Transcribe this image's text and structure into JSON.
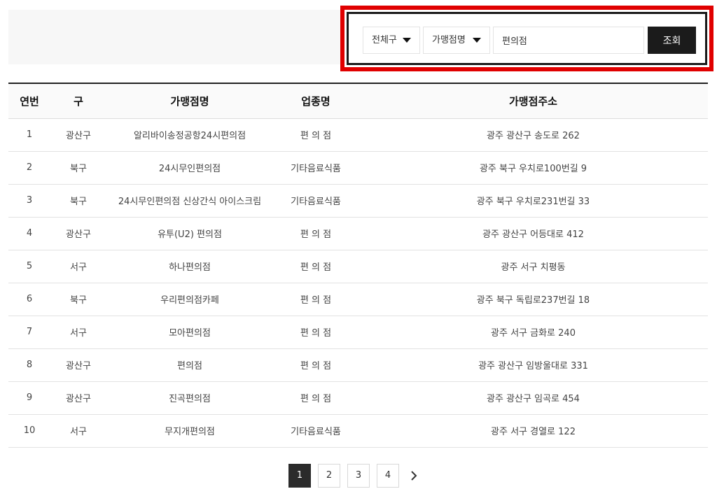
{
  "search": {
    "district_select": "전체구",
    "field_select": "가맹점명",
    "keyword_value": "편의점",
    "search_button": "조회"
  },
  "table": {
    "headers": [
      "연번",
      "구",
      "가맹점명",
      "업종명",
      "가맹점주소"
    ],
    "rows": [
      [
        "1",
        "광산구",
        "알리바이송정공항24시편의점",
        "편 의 점",
        "광주 광산구 송도로 262"
      ],
      [
        "2",
        "북구",
        "24시무인편의점",
        "기타음료식품",
        "광주 북구 우치로100번길 9"
      ],
      [
        "3",
        "북구",
        "24시무인편의점 신상간식 아이스크림",
        "기타음료식품",
        "광주 북구 우치로231번길 33"
      ],
      [
        "4",
        "광산구",
        "유투(U2) 편의점",
        "편 의 점",
        "광주 광산구 어등대로 412"
      ],
      [
        "5",
        "서구",
        "하나편의점",
        "편 의 점",
        "광주 서구 치평동"
      ],
      [
        "6",
        "북구",
        "우리편의점카페",
        "편 의 점",
        "광주 북구 독립로237번길 18"
      ],
      [
        "7",
        "서구",
        "모아편의점",
        "편 의 점",
        "광주 서구 금화로 240"
      ],
      [
        "8",
        "광산구",
        "편의점",
        "편 의 점",
        "광주 광산구 임방울대로 331"
      ],
      [
        "9",
        "광산구",
        "진곡편의점",
        "편 의 점",
        "광주 광산구 임곡로 454"
      ],
      [
        "10",
        "서구",
        "무지개편의점",
        "기타음료식품",
        "광주 서구 경열로 122"
      ]
    ]
  },
  "pagination": {
    "pages": [
      "1",
      "2",
      "3",
      "4"
    ],
    "current": "1",
    "next_icon": "chevron-right-icon"
  },
  "colors": {
    "highlight_border": "#e00000",
    "button_bg": "#1b1b1b"
  }
}
